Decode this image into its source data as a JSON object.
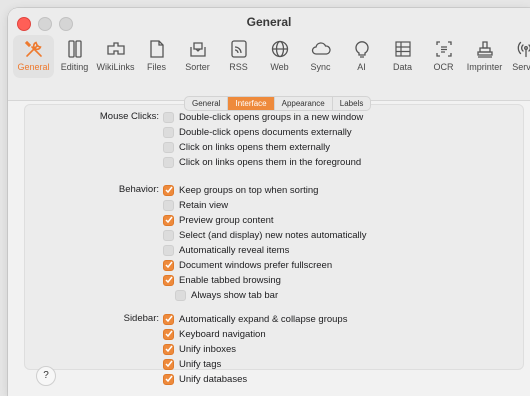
{
  "window": {
    "title": "General"
  },
  "toolbar": {
    "items": [
      {
        "label": "General",
        "icon": "tools-icon",
        "active": true
      },
      {
        "label": "Editing",
        "icon": "editing-icon"
      },
      {
        "label": "WikiLinks",
        "icon": "wikilinks-icon"
      },
      {
        "label": "Files",
        "icon": "files-icon"
      },
      {
        "label": "Sorter",
        "icon": "sorter-icon"
      },
      {
        "label": "RSS",
        "icon": "rss-icon"
      },
      {
        "label": "Web",
        "icon": "globe-icon"
      },
      {
        "label": "Sync",
        "icon": "cloud-icon"
      },
      {
        "label": "AI",
        "icon": "lightbulb-icon"
      },
      {
        "label": "Data",
        "icon": "data-icon"
      },
      {
        "label": "OCR",
        "icon": "ocr-icon"
      },
      {
        "label": "Imprinter",
        "icon": "stamp-icon"
      },
      {
        "label": "Server",
        "icon": "server-icon"
      }
    ]
  },
  "tabs": [
    "General",
    "Interface",
    "Appearance",
    "Labels"
  ],
  "active_tab": "Interface",
  "groups": {
    "mouse": {
      "label": "Mouse Clicks:",
      "options": [
        {
          "text": "Double-click opens groups in a new window",
          "checked": false
        },
        {
          "text": "Double-click opens documents externally",
          "checked": false
        },
        {
          "text": "Click on links opens them externally",
          "checked": false
        },
        {
          "text": "Click on links opens them in the foreground",
          "checked": false
        }
      ]
    },
    "behavior": {
      "label": "Behavior:",
      "options": [
        {
          "text": "Keep groups on top when sorting",
          "checked": true
        },
        {
          "text": "Retain view",
          "checked": false
        },
        {
          "text": "Preview group content",
          "checked": true
        },
        {
          "text": "Select (and display) new notes automatically",
          "checked": false
        },
        {
          "text": "Automatically reveal items",
          "checked": false
        },
        {
          "text": "Document windows prefer fullscreen",
          "checked": true
        },
        {
          "text": "Enable tabbed browsing",
          "checked": true
        },
        {
          "text": "Always show tab bar",
          "checked": false
        }
      ]
    },
    "sidebar": {
      "label": "Sidebar:",
      "options": [
        {
          "text": "Automatically expand & collapse groups",
          "checked": true
        },
        {
          "text": "Keyboard navigation",
          "checked": true
        },
        {
          "text": "Unify inboxes",
          "checked": true
        },
        {
          "text": "Unify tags",
          "checked": true
        },
        {
          "text": "Unify databases",
          "checked": true
        }
      ]
    }
  },
  "help": "?",
  "colors": {
    "accent": "#ee8a3c",
    "active_label": "#ee7a2f"
  }
}
